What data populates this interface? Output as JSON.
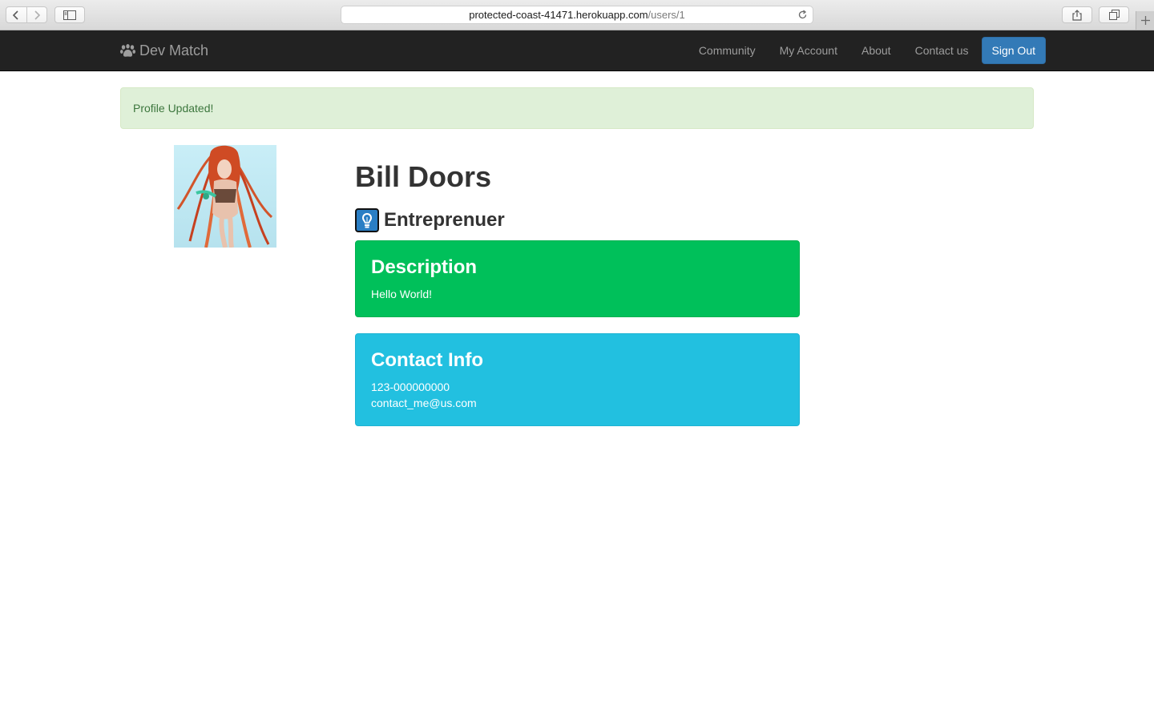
{
  "browser": {
    "url_host": "protected-coast-41471.herokuapp.com",
    "url_path": "/users/1"
  },
  "navbar": {
    "brand": "Dev Match",
    "links": [
      "Community",
      "My Account",
      "About",
      "Contact us"
    ],
    "sign_out_label": "Sign Out"
  },
  "alert": {
    "message": "Profile Updated!"
  },
  "profile": {
    "name": "Bill Doors",
    "plan": "Entreprenuer",
    "description": {
      "heading": "Description",
      "text": "Hello World!"
    },
    "contact": {
      "heading": "Contact Info",
      "phone": "123-000000000",
      "email": "contact_me@us.com"
    }
  },
  "colors": {
    "navbar_bg": "#222222",
    "primary_button": "#337ab7",
    "alert_success_bg": "#dff0d8",
    "alert_success_text": "#3c763d",
    "description_panel": "#00c05a",
    "contact_panel": "#22c0e0"
  },
  "icons": {
    "brand": "paw-icon",
    "plan": "lightbulb-icon"
  }
}
